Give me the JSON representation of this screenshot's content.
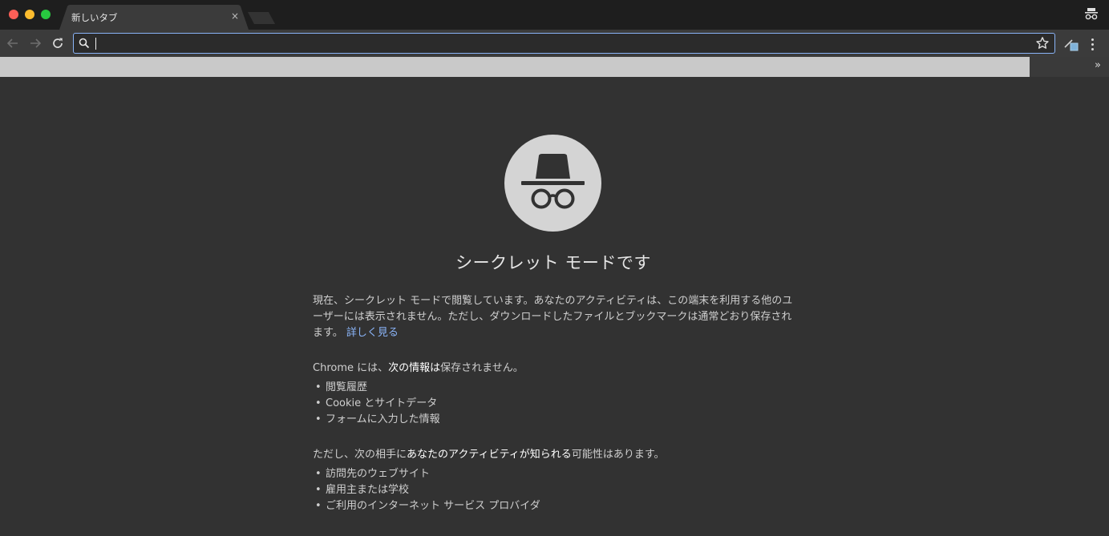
{
  "window": {
    "tab": {
      "title": "新しいタブ",
      "close_glyph": "×"
    }
  },
  "toolbar": {
    "omnibox": {
      "value": "",
      "placeholder": ""
    },
    "bookmark_bar_overflow_glyph": "»"
  },
  "content": {
    "heading": "シークレット モードです",
    "intro": {
      "text": "現在、シークレット モードで閲覧しています。あなたのアクティビティは、この端末を利用する他のユーザーには表示されません。ただし、ダウンロードしたファイルとブックマークは通常どおり保存されます。",
      "link": "詳しく見る"
    },
    "not_saved": {
      "lead_prefix": "Chrome には、",
      "lead_bold": "次の情報は",
      "lead_suffix": "保存されません。",
      "items": [
        "閲覧履歴",
        "Cookie とサイトデータ",
        "フォームに入力した情報"
      ]
    },
    "visible_to": {
      "lead_prefix": "ただし、次の相手に",
      "lead_bold": "あなたのアクティビティが知られる",
      "lead_suffix": "可能性はあります。",
      "items": [
        "訪問先のウェブサイト",
        "雇用主または学校",
        "ご利用のインターネット サービス プロバイダ"
      ]
    }
  },
  "colors": {
    "page_background": "#323232",
    "tabstrip_background": "#1e1e1e",
    "toolbar_background": "#3b3b3b",
    "link": "#8ab4f8",
    "hero_circle": "#d4d4d4"
  },
  "icons": [
    "incognito-icon",
    "back-arrow-icon",
    "forward-arrow-icon",
    "reload-icon",
    "search-icon",
    "star-icon",
    "extension-icon",
    "more-vert-icon",
    "chevron-double-right-icon"
  ]
}
